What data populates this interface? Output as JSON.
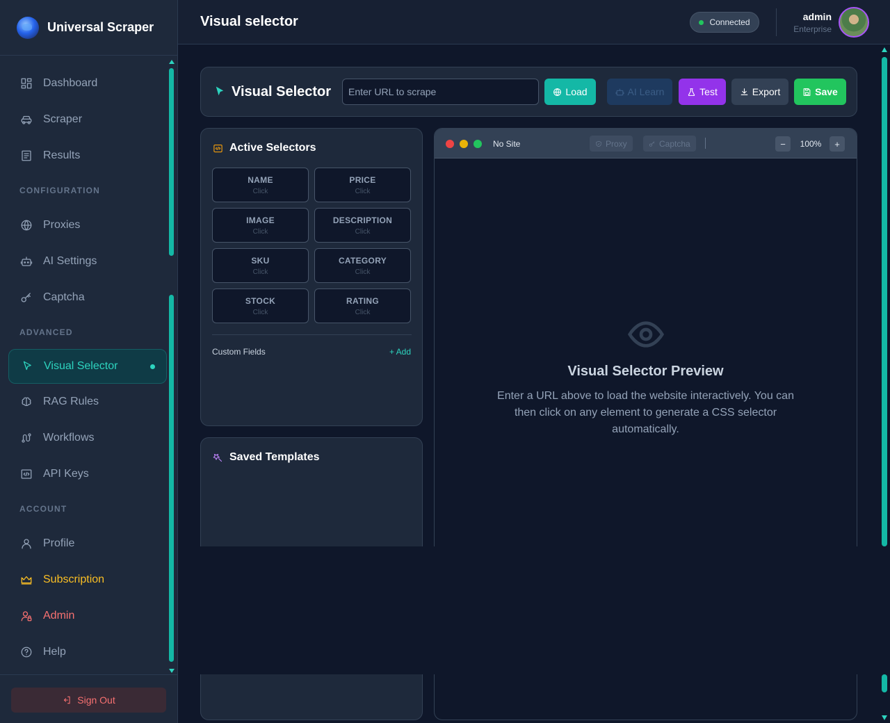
{
  "brand": {
    "name": "Universal Scraper"
  },
  "sidebar": {
    "items_main": [
      {
        "label": "Dashboard"
      },
      {
        "label": "Scraper"
      },
      {
        "label": "Results"
      }
    ],
    "section_configuration": "CONFIGURATION",
    "items_configuration": [
      {
        "label": "Proxies"
      },
      {
        "label": "AI Settings"
      },
      {
        "label": "Captcha"
      }
    ],
    "section_advanced": "ADVANCED",
    "items_advanced": [
      {
        "label": "Visual Selector"
      },
      {
        "label": "RAG Rules"
      },
      {
        "label": "Workflows"
      },
      {
        "label": "API Keys"
      }
    ],
    "section_account": "ACCOUNT",
    "items_account": [
      {
        "label": "Profile"
      },
      {
        "label": "Subscription"
      },
      {
        "label": "Admin"
      },
      {
        "label": "Help"
      }
    ],
    "sign_out": "Sign Out"
  },
  "header": {
    "title": "Visual selector",
    "status": "Connected",
    "user_name": "admin",
    "user_role": "Enterprise"
  },
  "toolbar": {
    "title": "Visual Selector",
    "url_placeholder": "Enter URL to scrape",
    "load": "Load",
    "ai_learn": "AI Learn",
    "test": "Test",
    "export": "Export",
    "save": "Save"
  },
  "selectors": {
    "title": "Active Selectors",
    "fields": [
      {
        "label": "NAME",
        "hint": "Click"
      },
      {
        "label": "PRICE",
        "hint": "Click"
      },
      {
        "label": "IMAGE",
        "hint": "Click"
      },
      {
        "label": "DESCRIPTION",
        "hint": "Click"
      },
      {
        "label": "SKU",
        "hint": "Click"
      },
      {
        "label": "CATEGORY",
        "hint": "Click"
      },
      {
        "label": "STOCK",
        "hint": "Click"
      },
      {
        "label": "RATING",
        "hint": "Click"
      }
    ],
    "custom_fields": "Custom Fields",
    "add": "+ Add"
  },
  "templates": {
    "title": "Saved Templates"
  },
  "preview": {
    "site": "No Site",
    "proxy": "Proxy",
    "captcha": "Captcha",
    "zoom_out": "−",
    "zoom": "100%",
    "zoom_in": "+",
    "empty_title": "Visual Selector Preview",
    "empty_text": "Enter a URL above to load the website interactively. You can then click on any element to generate a CSS selector automatically."
  },
  "colors": {
    "accent": "#14b8a6",
    "purple": "#9333ea",
    "green": "#22c55e",
    "gold": "#fbbf24",
    "danger": "#f87171"
  }
}
